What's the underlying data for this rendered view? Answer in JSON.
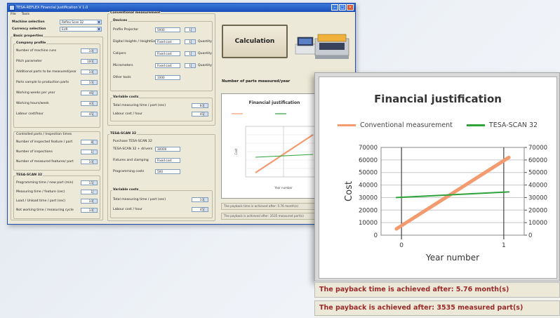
{
  "window": {
    "title": "TESA-REFLEX Financial Justification V 1.0",
    "menu": [
      "File",
      "Tools"
    ]
  },
  "selection": {
    "machine_label": "Machine selection",
    "machine_value": "Reflex Scan 32",
    "currency_label": "Currency selection",
    "currency_value": "EUR"
  },
  "left_groups": {
    "basic_title": "Basic properties",
    "company_title": "Company profile",
    "company_rows": [
      {
        "label": "Number of machine runs",
        "value": "10"
      },
      {
        "label": "Pitch parameter",
        "value": "100"
      },
      {
        "label": "Additional parts to be measured/year",
        "value": "10"
      },
      {
        "label": "Parts sample to production parts",
        "value": "10"
      },
      {
        "label": "Working weeks per year",
        "value": "46"
      },
      {
        "label": "Working hours/week",
        "value": "40"
      },
      {
        "label": "Labour cost/hour",
        "value": "45"
      }
    ],
    "sub_title": "Controlled parts / Inspection times",
    "sub_rows": [
      {
        "label": "Number of inspected feature / part",
        "value": "8"
      },
      {
        "label": "Number of inspections",
        "value": "1"
      },
      {
        "label": "Number of measured features/ part",
        "value": "10"
      }
    ],
    "tesa_title": "TESA-SCAN 32",
    "tesa_rows": [
      {
        "label": "Programming time / new part (min)",
        "value": "15"
      },
      {
        "label": "Measuring time / feature (sec)",
        "value": "1"
      },
      {
        "label": "Load / Unload time / part (sec)",
        "value": "10"
      },
      {
        "label": "Not working time / measuring cycle",
        "value": "10"
      }
    ]
  },
  "conventional": {
    "title": "Conventional measurement",
    "devices_title": "Devices",
    "rows": [
      {
        "label": "Profile Projector",
        "value": "5000",
        "count": "1",
        "unit": ""
      },
      {
        "label": "Digital Heights / HeightGauge",
        "value": "Fixed cost",
        "count": "1",
        "unit": "Quantity"
      },
      {
        "label": "Calipers",
        "value": "Fixed cost",
        "count": "1",
        "unit": "Quantity"
      },
      {
        "label": "Micrometers",
        "value": "Fixed cost",
        "count": "1",
        "unit": "Quantity"
      },
      {
        "label": "Other tools",
        "value": "1000",
        "count": "",
        "unit": ""
      }
    ],
    "labour_title": "Variable costs",
    "labour_rows": [
      {
        "label": "Total measuring time / part (sec)",
        "value": "60"
      },
      {
        "label": "Labour cost / hour",
        "value": "45"
      }
    ]
  },
  "tesa_machine": {
    "title": "TESA-SCAN 32",
    "sub_title": "Purchase TESA-SCAN 32",
    "rows": [
      {
        "label": "TESA-SCAN 32 + drivers",
        "value": "30000"
      },
      {
        "label": "Fixtures and clamping",
        "value": "Fixed cost"
      },
      {
        "label": "Programming costs",
        "value": "500"
      }
    ],
    "var_title": "Variable costs",
    "var_rows": [
      {
        "label": "Total measuring time / part (sec)",
        "value": "10"
      },
      {
        "label": "Labour cost / hour",
        "value": "45"
      }
    ]
  },
  "calc": {
    "button": "Calculation",
    "parts_label": "Number of parts measured/year"
  },
  "chart_data": {
    "type": "line",
    "title": "Financial justification",
    "xlabel": "Year number",
    "ylabel": "Cost",
    "x": [
      0,
      1
    ],
    "xticks": [
      "0",
      "1"
    ],
    "ylim": [
      0,
      70000
    ],
    "yticks": [
      0,
      10000,
      20000,
      30000,
      40000,
      50000,
      60000,
      70000
    ],
    "secondary_yticks": [
      0,
      10000,
      20000,
      30000,
      40000,
      50000,
      60000,
      70000
    ],
    "legend_position": "top",
    "grid": true,
    "series": [
      {
        "name": "Conventional measurement",
        "color": "#f39a6e",
        "x": [
          -0.05,
          1.05
        ],
        "values": [
          5000,
          62000
        ]
      },
      {
        "name": "TESA-SCAN 32",
        "color": "#2ea33a",
        "x": [
          -0.05,
          1.05
        ],
        "values": [
          30000,
          34500
        ]
      }
    ]
  },
  "results": {
    "payback_time": "The payback time is achieved after: 5.76 month(s)",
    "payback_parts": "The payback is achieved after: 3535 measured part(s)"
  }
}
